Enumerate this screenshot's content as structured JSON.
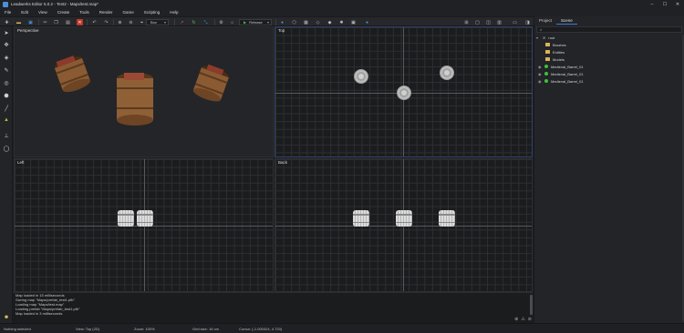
{
  "window": {
    "title": "Leadwerks Editor 5.0.2 - Test2 - Maps/test.map*"
  },
  "menu": [
    "File",
    "Edit",
    "View",
    "Create",
    "Tools",
    "Render",
    "Game",
    "Scripting",
    "Help"
  ],
  "toolbar": {
    "select_mode": "Box",
    "config": "Release",
    "icons": [
      "new-icon",
      "open-icon",
      "save-icon",
      "cut-icon",
      "copy-icon",
      "paste-icon",
      "delete-icon",
      "undo-icon",
      "redo-icon",
      "zoom-in-icon",
      "zoom-out-icon",
      "snap-icon",
      "move-icon",
      "rotate-icon",
      "scale-icon",
      "play-icon",
      "settings-icon"
    ]
  },
  "viewports": {
    "perspective": "Perspective",
    "top": "Top",
    "left": "Left",
    "back": "Back"
  },
  "console": {
    "lines": [
      "Map loaded in 15 milliseconds",
      "Saving map \"Maps/prefab_test1.pfb\"",
      "Loading map \"Maps/test.map\"",
      "Loading prefab \"Maps/prefab_test1.pfb\"",
      "Map loaded in 3 milliseconds"
    ]
  },
  "right_panel": {
    "tabs": [
      "Project",
      "Scene"
    ],
    "active_tab": "Scene",
    "tree": [
      {
        "label": "root",
        "type": "root"
      },
      {
        "label": "Brushes",
        "type": "folder"
      },
      {
        "label": "Entities",
        "type": "folder"
      },
      {
        "label": "Models",
        "type": "folder"
      },
      {
        "label": "Medieval_Barrel_01",
        "type": "object"
      },
      {
        "label": "Medieval_Barrel_01",
        "type": "object"
      },
      {
        "label": "Medieval_Barrel_01",
        "type": "object"
      }
    ]
  },
  "status": {
    "selection": "Nothing selected",
    "view": "View: Top (2D)",
    "zoom": "Zoom: 100%",
    "grid": "Grid size: 16 cm",
    "cursor": "Cursor: (-1.000424, 4.720)"
  },
  "colors": {
    "accent": "#3c7bd8",
    "object": "#3cc13c",
    "folder": "#d9b35a"
  }
}
